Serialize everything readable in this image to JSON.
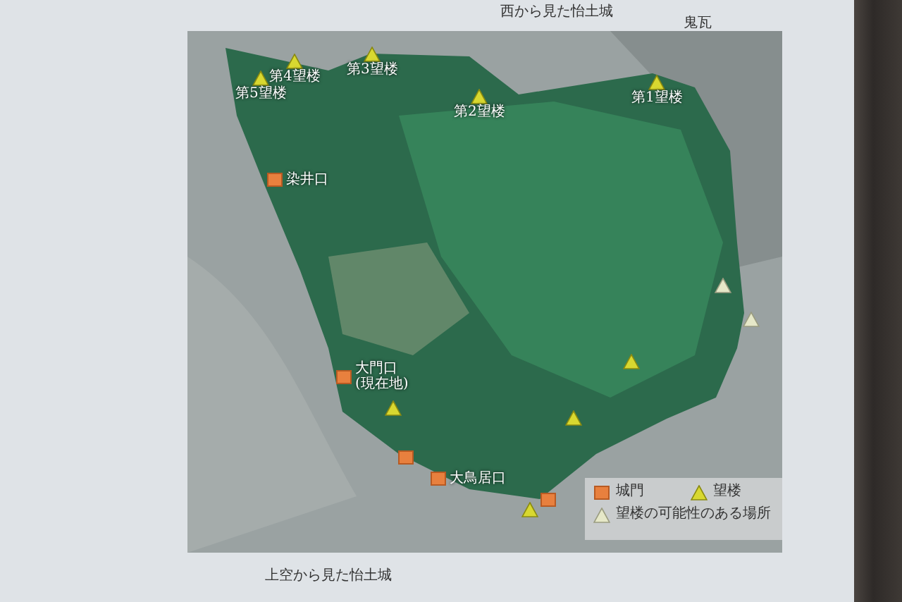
{
  "board": {
    "top_captions": [
      "西から見た怡土城",
      "鬼瓦"
    ],
    "map": {
      "markers": [
        {
          "kind": "tower",
          "labels": [
            "第5望楼"
          ]
        },
        {
          "kind": "tower",
          "labels": [
            "第4望楼"
          ]
        },
        {
          "kind": "tower",
          "labels": [
            "第3望楼"
          ]
        },
        {
          "kind": "tower",
          "labels": [
            "第2望楼"
          ]
        },
        {
          "kind": "tower",
          "labels": [
            "第1望楼"
          ]
        },
        {
          "kind": "gate",
          "labels": [
            "染井口"
          ]
        },
        {
          "kind": "gate",
          "labels": [
            "大門口",
            "(現在地)"
          ]
        },
        {
          "kind": "tower"
        },
        {
          "kind": "tower"
        },
        {
          "kind": "tower"
        },
        {
          "kind": "gate"
        },
        {
          "kind": "gate",
          "labels": [
            "大鳥居口"
          ]
        },
        {
          "kind": "gate"
        },
        {
          "kind": "tower"
        },
        {
          "kind": "possible"
        },
        {
          "kind": "possible"
        }
      ],
      "legend": [
        {
          "kind": "gate",
          "label": "城門"
        },
        {
          "kind": "tower",
          "label": "望楼"
        },
        {
          "kind": "possible",
          "label": "望楼の可能性のある場所"
        }
      ]
    },
    "caption": "上空から見た怡土城"
  }
}
